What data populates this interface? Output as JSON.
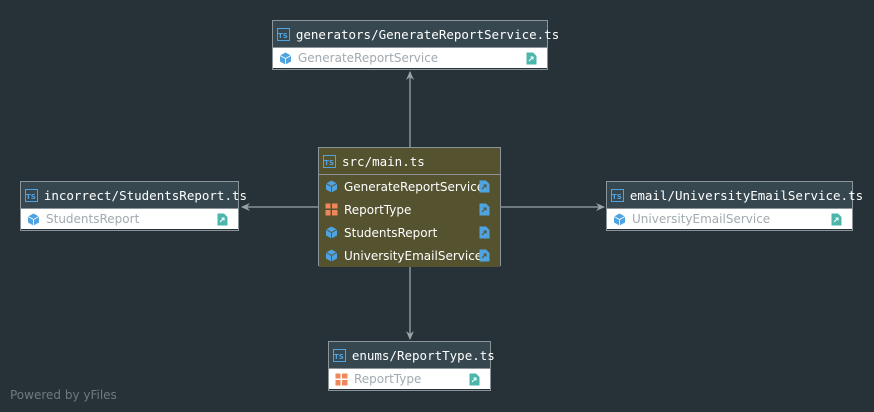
{
  "footer": "Powered by yFiles",
  "colors": {
    "background": "#263238",
    "header_bg": "#37474f",
    "main_bg": "#555230",
    "edge": "#9aa3a8",
    "class_icon": "#4fa3e0",
    "enum_icon": "#f0875a",
    "export_icon_light": "#4db6ac",
    "export_icon_main": "#4fa3e0"
  },
  "nodes": {
    "top": {
      "file": "generators/GenerateReportService.ts",
      "members": [
        {
          "name": "GenerateReportService",
          "kind": "class"
        }
      ]
    },
    "main": {
      "file": "src/main.ts",
      "members": [
        {
          "name": "GenerateReportService",
          "kind": "class"
        },
        {
          "name": "ReportType",
          "kind": "enum"
        },
        {
          "name": "StudentsReport",
          "kind": "class"
        },
        {
          "name": "UniversityEmailService",
          "kind": "class"
        }
      ]
    },
    "left": {
      "file": "incorrect/StudentsReport.ts",
      "members": [
        {
          "name": "StudentsReport",
          "kind": "class"
        }
      ]
    },
    "right": {
      "file": "email/UniversityEmailService.ts",
      "members": [
        {
          "name": "UniversityEmailService",
          "kind": "class"
        }
      ]
    },
    "bottom": {
      "file": "enums/ReportType.ts",
      "members": [
        {
          "name": "ReportType",
          "kind": "enum"
        }
      ]
    }
  },
  "ts_icon_label": "TS"
}
